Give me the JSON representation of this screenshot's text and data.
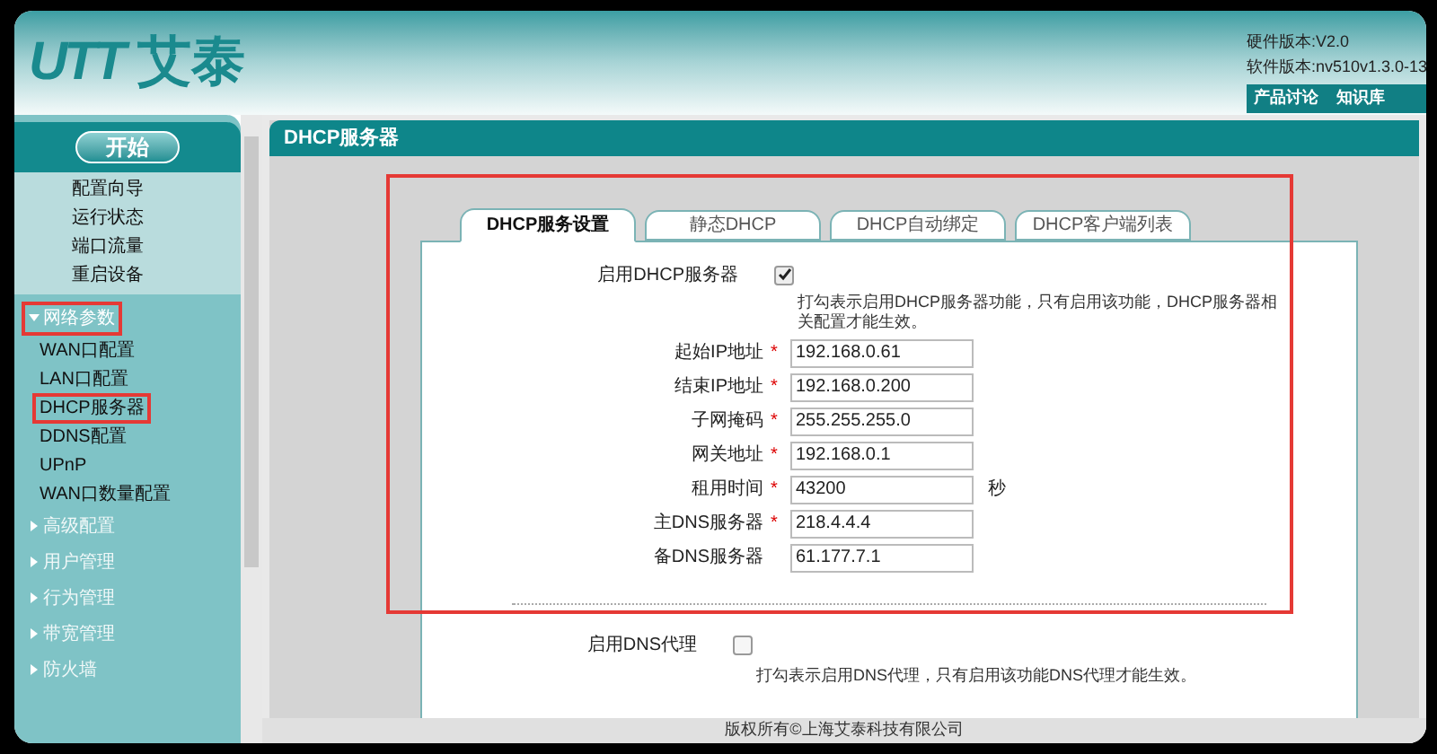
{
  "header": {
    "logo_mark": "UTT",
    "logo_text": "艾泰",
    "versions": [
      "硬件版本:V2.0",
      "软件版本:nv510v1.3.0-13"
    ],
    "links": [
      "产品讨论",
      "知识库"
    ]
  },
  "sidebar": {
    "start_button": "开始",
    "items": [
      "配置向导",
      "运行状态",
      "端口流量",
      "重启设备"
    ],
    "groups": [
      {
        "label": "网络参数",
        "expanded": true,
        "highlighted": true,
        "children": [
          {
            "label": "WAN口配置",
            "highlighted": false
          },
          {
            "label": "LAN口配置",
            "highlighted": false
          },
          {
            "label": "DHCP服务器",
            "highlighted": true
          },
          {
            "label": "DDNS配置",
            "highlighted": false
          },
          {
            "label": "UPnP",
            "highlighted": false
          },
          {
            "label": "WAN口数量配置",
            "highlighted": false
          }
        ]
      },
      {
        "label": "高级配置",
        "expanded": false,
        "highlighted": false
      },
      {
        "label": "用户管理",
        "expanded": false,
        "highlighted": false
      },
      {
        "label": "行为管理",
        "expanded": false,
        "highlighted": false
      },
      {
        "label": "带宽管理",
        "expanded": false,
        "highlighted": false
      },
      {
        "label": "防火墙",
        "expanded": false,
        "highlighted": false
      }
    ]
  },
  "page": {
    "title": "DHCP服务器",
    "tabs": [
      {
        "label": "DHCP服务设置",
        "selected": true
      },
      {
        "label": "静态DHCP",
        "selected": false
      },
      {
        "label": "DHCP自动绑定",
        "selected": false
      },
      {
        "label": "DHCP客户端列表",
        "selected": false
      }
    ],
    "enable_dhcp": {
      "label": "启用DHCP服务器",
      "checked": true,
      "hint": "打勾表示启用DHCP服务器功能，只有启用该功能，DHCP服务器相关配置才能生效。"
    },
    "fields": [
      {
        "label": "起始IP地址",
        "required": true,
        "value": "192.168.0.61"
      },
      {
        "label": "结束IP地址",
        "required": true,
        "value": "192.168.0.200"
      },
      {
        "label": "子网掩码",
        "required": true,
        "value": "255.255.255.0"
      },
      {
        "label": "网关地址",
        "required": true,
        "value": "192.168.0.1"
      },
      {
        "label": "租用时间",
        "required": true,
        "value": "43200",
        "unit": "秒"
      },
      {
        "label": "主DNS服务器",
        "required": true,
        "value": "218.4.4.4"
      },
      {
        "label": "备DNS服务器",
        "required": false,
        "value": "61.177.7.1"
      }
    ],
    "required_mark": "*",
    "enable_dns_proxy": {
      "label": "启用DNS代理",
      "checked": false,
      "hint": "打勾表示启用DNS代理，只有启用该功能DNS代理才能生效。"
    }
  },
  "footer": "版权所有©上海艾泰科技有限公司"
}
